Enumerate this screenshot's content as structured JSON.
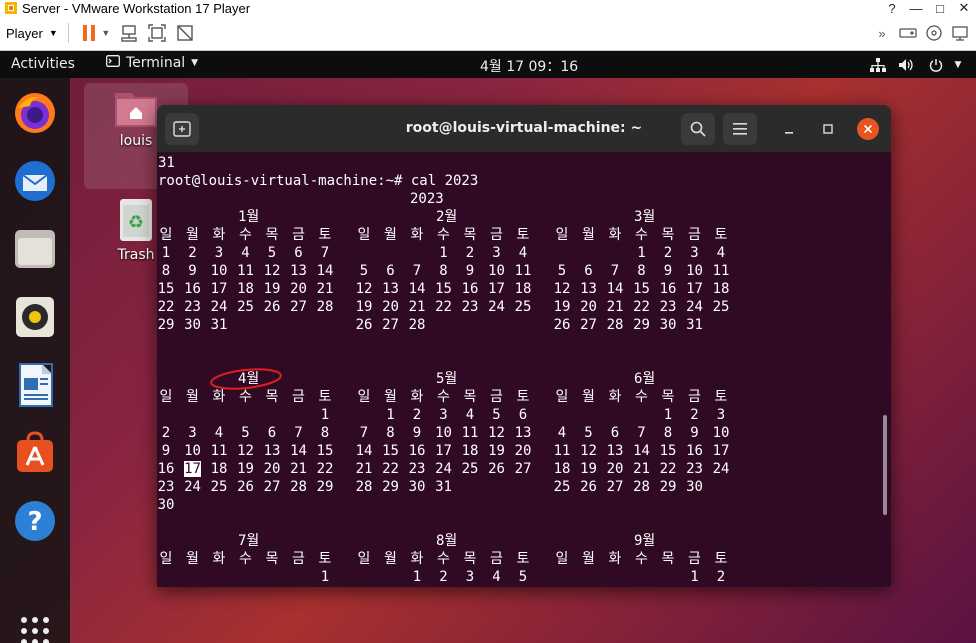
{
  "vm": {
    "title": "Server - VMware Workstation 17 Player",
    "player_menu": "Player"
  },
  "topbar": {
    "activities": "Activities",
    "app_menu": "Terminal",
    "clock": "4월 17  09：16"
  },
  "desktop": {
    "home_label": "louis",
    "trash_label": "Trash"
  },
  "terminal": {
    "title": "root@louis-virtual-machine: ~",
    "line_prev": "31",
    "prompt_line": "root@louis-virtual-machine:~# cal 2023",
    "year": "2023",
    "weekdays": [
      "일",
      "월",
      "화",
      "수",
      "목",
      "금",
      "토"
    ],
    "month_rows": [
      {
        "months": [
          {
            "name": "1월",
            "weeks": [
              [
                "1",
                "2",
                "3",
                "4",
                "5",
                "6",
                "7"
              ],
              [
                "8",
                "9",
                "10",
                "11",
                "12",
                "13",
                "14"
              ],
              [
                "15",
                "16",
                "17",
                "18",
                "19",
                "20",
                "21"
              ],
              [
                "22",
                "23",
                "24",
                "25",
                "26",
                "27",
                "28"
              ],
              [
                "29",
                "30",
                "31",
                "",
                "",
                "",
                ""
              ]
            ]
          },
          {
            "name": "2월",
            "weeks": [
              [
                "",
                "",
                "",
                "1",
                "2",
                "3",
                "4"
              ],
              [
                "5",
                "6",
                "7",
                "8",
                "9",
                "10",
                "11"
              ],
              [
                "12",
                "13",
                "14",
                "15",
                "16",
                "17",
                "18"
              ],
              [
                "19",
                "20",
                "21",
                "22",
                "23",
                "24",
                "25"
              ],
              [
                "26",
                "27",
                "28",
                "",
                "",
                "",
                ""
              ]
            ]
          },
          {
            "name": "3월",
            "weeks": [
              [
                "",
                "",
                "",
                "1",
                "2",
                "3",
                "4"
              ],
              [
                "5",
                "6",
                "7",
                "8",
                "9",
                "10",
                "11"
              ],
              [
                "12",
                "13",
                "14",
                "15",
                "16",
                "17",
                "18"
              ],
              [
                "19",
                "20",
                "21",
                "22",
                "23",
                "24",
                "25"
              ],
              [
                "26",
                "27",
                "28",
                "29",
                "30",
                "31",
                ""
              ]
            ]
          }
        ]
      },
      {
        "months": [
          {
            "name": "4월",
            "weeks": [
              [
                "",
                "",
                "",
                "",
                "",
                "",
                "1"
              ],
              [
                "2",
                "3",
                "4",
                "5",
                "6",
                "7",
                "8"
              ],
              [
                "9",
                "10",
                "11",
                "12",
                "13",
                "14",
                "15"
              ],
              [
                "16",
                "17",
                "18",
                "19",
                "20",
                "21",
                "22"
              ],
              [
                "23",
                "24",
                "25",
                "26",
                "27",
                "28",
                "29"
              ],
              [
                "30",
                "",
                "",
                "",
                "",
                "",
                ""
              ]
            ]
          },
          {
            "name": "5월",
            "weeks": [
              [
                "",
                "1",
                "2",
                "3",
                "4",
                "5",
                "6"
              ],
              [
                "7",
                "8",
                "9",
                "10",
                "11",
                "12",
                "13"
              ],
              [
                "14",
                "15",
                "16",
                "17",
                "18",
                "19",
                "20"
              ],
              [
                "21",
                "22",
                "23",
                "24",
                "25",
                "26",
                "27"
              ],
              [
                "28",
                "29",
                "30",
                "31",
                "",
                "",
                ""
              ]
            ]
          },
          {
            "name": "6월",
            "weeks": [
              [
                "",
                "",
                "",
                "",
                "1",
                "2",
                "3"
              ],
              [
                "4",
                "5",
                "6",
                "7",
                "8",
                "9",
                "10"
              ],
              [
                "11",
                "12",
                "13",
                "14",
                "15",
                "16",
                "17"
              ],
              [
                "18",
                "19",
                "20",
                "21",
                "22",
                "23",
                "24"
              ],
              [
                "25",
                "26",
                "27",
                "28",
                "29",
                "30",
                ""
              ]
            ]
          }
        ]
      },
      {
        "months": [
          {
            "name": "7월",
            "weeks": [
              [
                "",
                "",
                "",
                "",
                "",
                "",
                "1"
              ]
            ]
          },
          {
            "name": "8월",
            "weeks": [
              [
                "",
                "",
                "1",
                "2",
                "3",
                "4",
                "5"
              ]
            ]
          },
          {
            "name": "9월",
            "weeks": [
              [
                "",
                "",
                "",
                "",
                "",
                "1",
                "2"
              ]
            ]
          }
        ]
      }
    ],
    "highlighted_day": "17",
    "colors": {
      "background": "#300a24",
      "foreground": "#ffffff",
      "annotation": "#e0201c"
    }
  }
}
